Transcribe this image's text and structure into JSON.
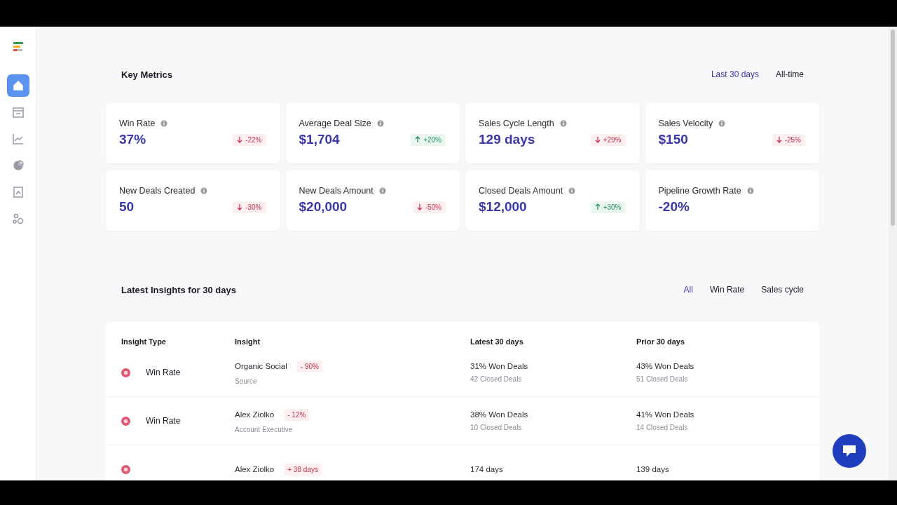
{
  "sidebar": {
    "items": [
      {
        "selected": true
      },
      {
        "selected": false
      },
      {
        "selected": false
      },
      {
        "selected": false
      },
      {
        "selected": false
      },
      {
        "selected": false
      }
    ]
  },
  "key_metrics": {
    "title": "Key Metrics",
    "ranges": [
      {
        "label": "Last 30 days",
        "selected": true
      },
      {
        "label": "All-time",
        "selected": false
      }
    ],
    "cards": [
      {
        "label": "Win Rate",
        "value": "37%",
        "delta": {
          "increase": false,
          "text": "-22%"
        }
      },
      {
        "label": "Average Deal Size",
        "value": "$1,704",
        "delta": {
          "increase": true,
          "text": "+20%"
        }
      },
      {
        "label": "Sales Cycle Length",
        "value": "129 days",
        "delta": {
          "increase": false,
          "text": "+29%"
        }
      },
      {
        "label": "Sales Velocity",
        "value": "$150",
        "delta": {
          "increase": false,
          "text": "-25%"
        }
      },
      {
        "label": "New Deals Created",
        "value": "50",
        "delta": {
          "increase": false,
          "text": "-30%"
        }
      },
      {
        "label": "New Deals Amount",
        "value": "$20,000",
        "delta": {
          "increase": false,
          "text": "-50%"
        }
      },
      {
        "label": "Closed Deals Amount",
        "value": "$12,000",
        "delta": {
          "increase": true,
          "text": "+30%"
        }
      },
      {
        "label": "Pipeline Growth Rate",
        "value": "-20%"
      }
    ]
  },
  "insights": {
    "title": "Latest Insights for 30 days",
    "filters": [
      {
        "label": "All",
        "selected": true
      },
      {
        "label": "Win Rate",
        "selected": false
      },
      {
        "label": "Sales cycle",
        "selected": false
      }
    ],
    "columns": [
      "Insight Type",
      "Insight",
      "Latest 30 days",
      "Prior 30 days"
    ],
    "rows": [
      {
        "type": "Win Rate",
        "name": "Organic Social",
        "change": "- 90%",
        "sub": "Source",
        "latest": "31% Won Deals",
        "latest_sub": "42 Closed Deals",
        "prior": "43% Won Deals",
        "prior_sub": "51 Closed Deals"
      },
      {
        "type": "Win Rate",
        "name": "Alex Ziolko",
        "change": "- 12%",
        "sub": "Account Executive",
        "latest": "38% Won Deals",
        "latest_sub": "10 Closed Deals",
        "prior": "41% Won Deals",
        "prior_sub": "14 Closed Deals"
      },
      {
        "name": "Alex Ziolko",
        "change": "+ 38 days",
        "latest": "174 days",
        "prior": "139 days"
      }
    ]
  }
}
